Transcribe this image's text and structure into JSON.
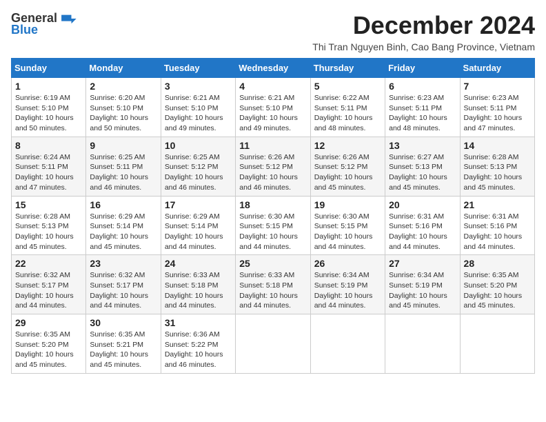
{
  "header": {
    "logo_general": "General",
    "logo_blue": "Blue",
    "month_title": "December 2024",
    "location": "Thi Tran Nguyen Binh, Cao Bang Province, Vietnam"
  },
  "days_of_week": [
    "Sunday",
    "Monday",
    "Tuesday",
    "Wednesday",
    "Thursday",
    "Friday",
    "Saturday"
  ],
  "weeks": [
    [
      {
        "day": "1",
        "sunrise": "6:19 AM",
        "sunset": "5:10 PM",
        "daylight": "10 hours and 50 minutes."
      },
      {
        "day": "2",
        "sunrise": "6:20 AM",
        "sunset": "5:10 PM",
        "daylight": "10 hours and 50 minutes."
      },
      {
        "day": "3",
        "sunrise": "6:21 AM",
        "sunset": "5:10 PM",
        "daylight": "10 hours and 49 minutes."
      },
      {
        "day": "4",
        "sunrise": "6:21 AM",
        "sunset": "5:10 PM",
        "daylight": "10 hours and 49 minutes."
      },
      {
        "day": "5",
        "sunrise": "6:22 AM",
        "sunset": "5:11 PM",
        "daylight": "10 hours and 48 minutes."
      },
      {
        "day": "6",
        "sunrise": "6:23 AM",
        "sunset": "5:11 PM",
        "daylight": "10 hours and 48 minutes."
      },
      {
        "day": "7",
        "sunrise": "6:23 AM",
        "sunset": "5:11 PM",
        "daylight": "10 hours and 47 minutes."
      }
    ],
    [
      {
        "day": "8",
        "sunrise": "6:24 AM",
        "sunset": "5:11 PM",
        "daylight": "10 hours and 47 minutes."
      },
      {
        "day": "9",
        "sunrise": "6:25 AM",
        "sunset": "5:11 PM",
        "daylight": "10 hours and 46 minutes."
      },
      {
        "day": "10",
        "sunrise": "6:25 AM",
        "sunset": "5:12 PM",
        "daylight": "10 hours and 46 minutes."
      },
      {
        "day": "11",
        "sunrise": "6:26 AM",
        "sunset": "5:12 PM",
        "daylight": "10 hours and 46 minutes."
      },
      {
        "day": "12",
        "sunrise": "6:26 AM",
        "sunset": "5:12 PM",
        "daylight": "10 hours and 45 minutes."
      },
      {
        "day": "13",
        "sunrise": "6:27 AM",
        "sunset": "5:13 PM",
        "daylight": "10 hours and 45 minutes."
      },
      {
        "day": "14",
        "sunrise": "6:28 AM",
        "sunset": "5:13 PM",
        "daylight": "10 hours and 45 minutes."
      }
    ],
    [
      {
        "day": "15",
        "sunrise": "6:28 AM",
        "sunset": "5:13 PM",
        "daylight": "10 hours and 45 minutes."
      },
      {
        "day": "16",
        "sunrise": "6:29 AM",
        "sunset": "5:14 PM",
        "daylight": "10 hours and 45 minutes."
      },
      {
        "day": "17",
        "sunrise": "6:29 AM",
        "sunset": "5:14 PM",
        "daylight": "10 hours and 44 minutes."
      },
      {
        "day": "18",
        "sunrise": "6:30 AM",
        "sunset": "5:15 PM",
        "daylight": "10 hours and 44 minutes."
      },
      {
        "day": "19",
        "sunrise": "6:30 AM",
        "sunset": "5:15 PM",
        "daylight": "10 hours and 44 minutes."
      },
      {
        "day": "20",
        "sunrise": "6:31 AM",
        "sunset": "5:16 PM",
        "daylight": "10 hours and 44 minutes."
      },
      {
        "day": "21",
        "sunrise": "6:31 AM",
        "sunset": "5:16 PM",
        "daylight": "10 hours and 44 minutes."
      }
    ],
    [
      {
        "day": "22",
        "sunrise": "6:32 AM",
        "sunset": "5:17 PM",
        "daylight": "10 hours and 44 minutes."
      },
      {
        "day": "23",
        "sunrise": "6:32 AM",
        "sunset": "5:17 PM",
        "daylight": "10 hours and 44 minutes."
      },
      {
        "day": "24",
        "sunrise": "6:33 AM",
        "sunset": "5:18 PM",
        "daylight": "10 hours and 44 minutes."
      },
      {
        "day": "25",
        "sunrise": "6:33 AM",
        "sunset": "5:18 PM",
        "daylight": "10 hours and 44 minutes."
      },
      {
        "day": "26",
        "sunrise": "6:34 AM",
        "sunset": "5:19 PM",
        "daylight": "10 hours and 44 minutes."
      },
      {
        "day": "27",
        "sunrise": "6:34 AM",
        "sunset": "5:19 PM",
        "daylight": "10 hours and 45 minutes."
      },
      {
        "day": "28",
        "sunrise": "6:35 AM",
        "sunset": "5:20 PM",
        "daylight": "10 hours and 45 minutes."
      }
    ],
    [
      {
        "day": "29",
        "sunrise": "6:35 AM",
        "sunset": "5:20 PM",
        "daylight": "10 hours and 45 minutes."
      },
      {
        "day": "30",
        "sunrise": "6:35 AM",
        "sunset": "5:21 PM",
        "daylight": "10 hours and 45 minutes."
      },
      {
        "day": "31",
        "sunrise": "6:36 AM",
        "sunset": "5:22 PM",
        "daylight": "10 hours and 46 minutes."
      },
      null,
      null,
      null,
      null
    ]
  ]
}
